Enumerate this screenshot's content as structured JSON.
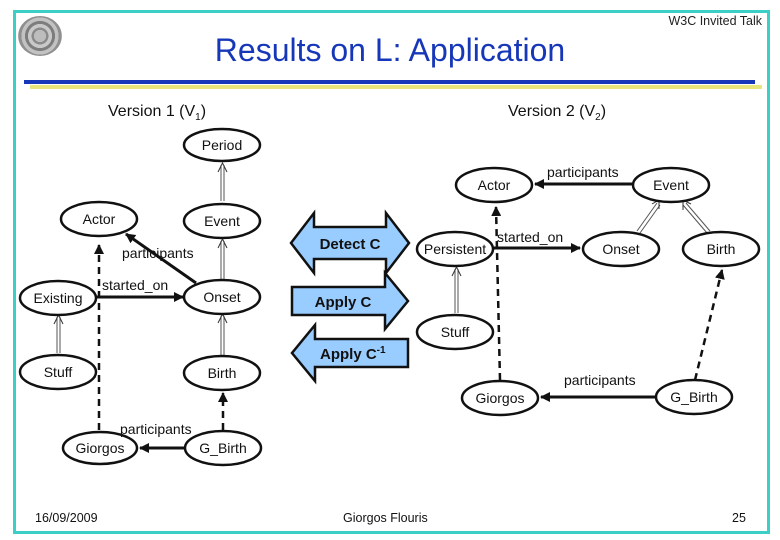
{
  "header": {
    "talk_label": "W3C Invited Talk",
    "title": "Results on L: Application",
    "logo_icon": "university-seal-icon"
  },
  "colors": {
    "frame": "#3ccfc6",
    "title": "#1637b8",
    "rule_blue": "#1637b8",
    "rule_yellow": "#e8e57a",
    "arrow_fill": "#99ccff"
  },
  "versions": {
    "v1": {
      "label": "Version 1 (V",
      "sub": "1",
      "close": ")"
    },
    "v2": {
      "label": "Version 2 (V",
      "sub": "2",
      "close": ")"
    }
  },
  "diagram_v1": {
    "nodes": {
      "period": "Period",
      "actor": "Actor",
      "event": "Event",
      "existing": "Existing",
      "onset": "Onset",
      "stuff": "Stuff",
      "birth": "Birth",
      "giorgos": "Giorgos",
      "g_birth": "G_Birth"
    },
    "edges": {
      "participants_1": "participants",
      "started_on": "started_on",
      "participants_2": "participants"
    }
  },
  "diagram_v2": {
    "nodes": {
      "actor": "Actor",
      "event": "Event",
      "persistent": "Persistent",
      "onset": "Onset",
      "birth": "Birth",
      "stuff": "Stuff",
      "giorgos": "Giorgos",
      "g_birth": "G_Birth"
    },
    "edges": {
      "participants_1": "participants",
      "started_on": "started_on",
      "participants_2": "participants"
    }
  },
  "actions": {
    "detect": "Detect C",
    "apply": "Apply C",
    "apply_inverse": "Apply C",
    "apply_inverse_sup": "-1"
  },
  "footer": {
    "date": "16/09/2009",
    "author": "Giorgos Flouris",
    "page": "25"
  }
}
